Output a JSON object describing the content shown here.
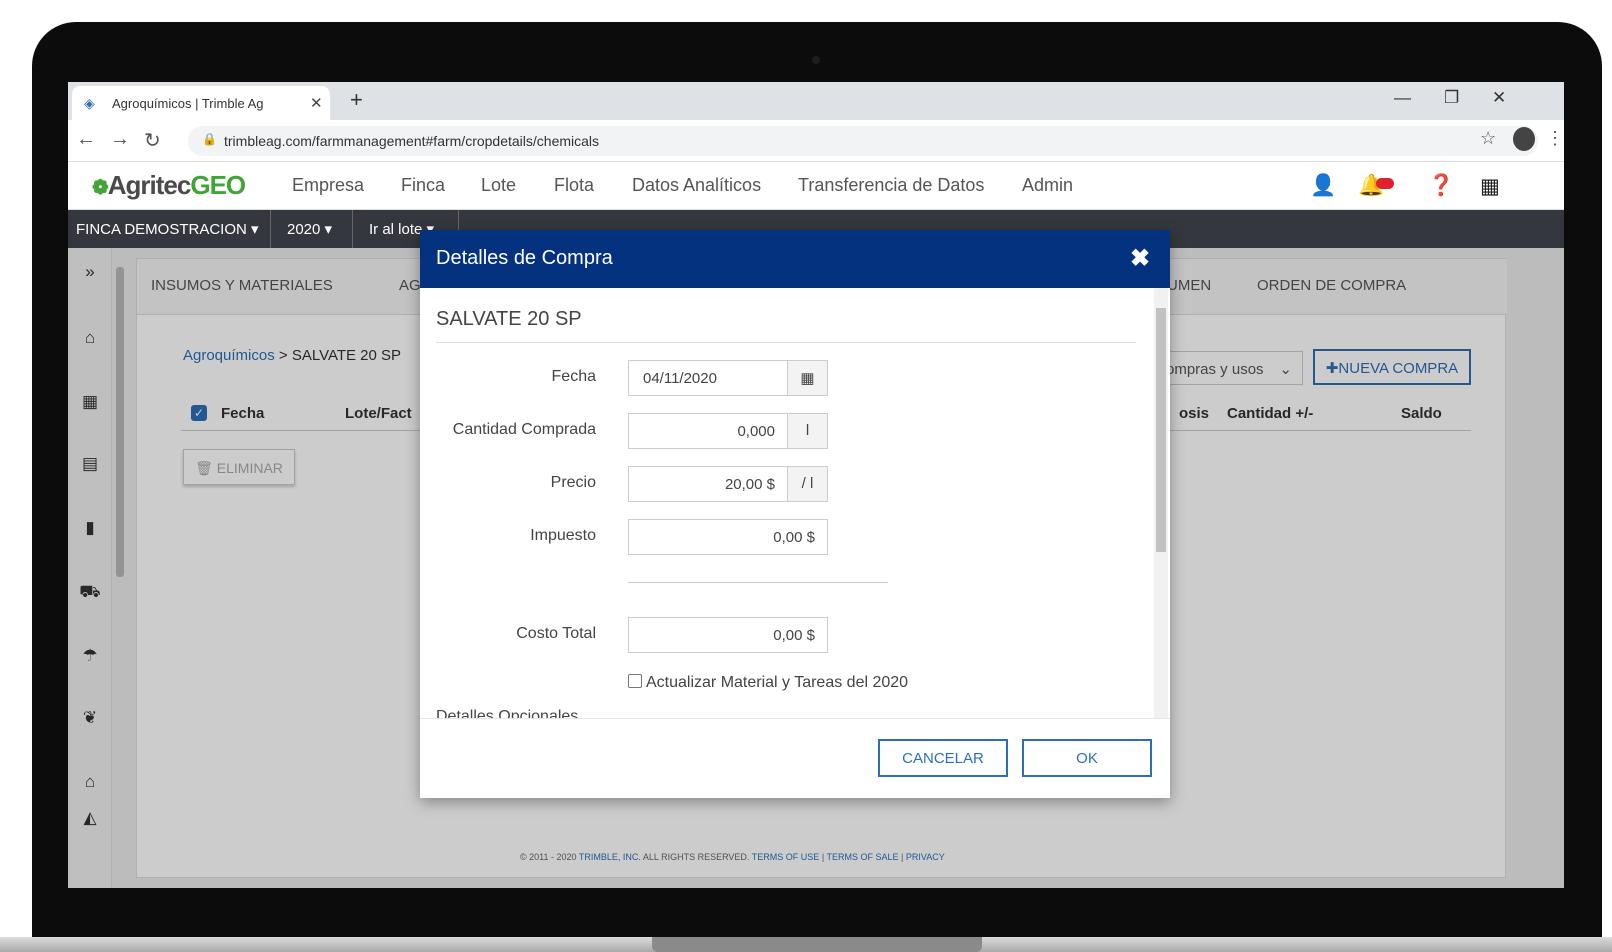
{
  "browser": {
    "tab_title": "Agroquímicos | Trimble Ag",
    "new_tab": "+",
    "url": "trimbleag.com/farmmanagement#farm/cropdetails/chemicals"
  },
  "app": {
    "logo_prefix": "Agritec",
    "logo_suffix": "GEO",
    "nav": [
      "Empresa",
      "Finca",
      "Lote",
      "Flota",
      "Datos Analíticos",
      "Transferencia de Datos",
      "Admin"
    ],
    "context": {
      "farm": "FINCA DEMOSTRACION ▾",
      "year": "2020 ▾",
      "lot": "Ir al lote ▾"
    }
  },
  "panel": {
    "tabs": [
      "INSUMOS Y MATERIALES",
      "AG",
      "UMEN",
      "ORDEN DE COMPRA"
    ],
    "breadcrumb_link": "Agroquímicos",
    "breadcrumb_sep": " > ",
    "breadcrumb_current": "SALVATE 20 SP",
    "filter_select": "ompras y usos",
    "new_button": "NUEVA COMPRA",
    "delete_button": "ELIMINAR",
    "columns": [
      "Fecha",
      "Lote/Fact",
      "osis",
      "Cantidad +/-",
      "Saldo"
    ]
  },
  "footer": {
    "copyright": "© 2011 - 2020",
    "company": "TRIMBLE, INC.",
    "rights": "ALL RIGHTS RESERVED.",
    "terms_use": "TERMS OF USE",
    "terms_sale": "TERMS OF SALE",
    "privacy": "PRIVACY",
    "sep": "|"
  },
  "modal": {
    "title": "Detalles de Compra",
    "product": "SALVATE 20 SP",
    "fields": {
      "fecha": {
        "label": "Fecha",
        "value": "04/11/2020"
      },
      "cantidad": {
        "label": "Cantidad Comprada",
        "value": "0,000",
        "unit": "l"
      },
      "precio": {
        "label": "Precio",
        "value": "20,00 $",
        "unit": "/ l"
      },
      "impuesto": {
        "label": "Impuesto",
        "value": "0,00 $"
      },
      "costo_total": {
        "label": "Costo Total",
        "value": "0,00 $"
      }
    },
    "checkbox_label": "Actualizar Material y Tareas del 2020",
    "partial_text": "Detalles Opcionales",
    "cancel": "CANCELAR",
    "ok": "OK"
  },
  "colors": {
    "modal_header": "#04327f",
    "accent": "#2d6fb7",
    "logo_green": "#3fa535",
    "context_bar": "#34373d"
  }
}
